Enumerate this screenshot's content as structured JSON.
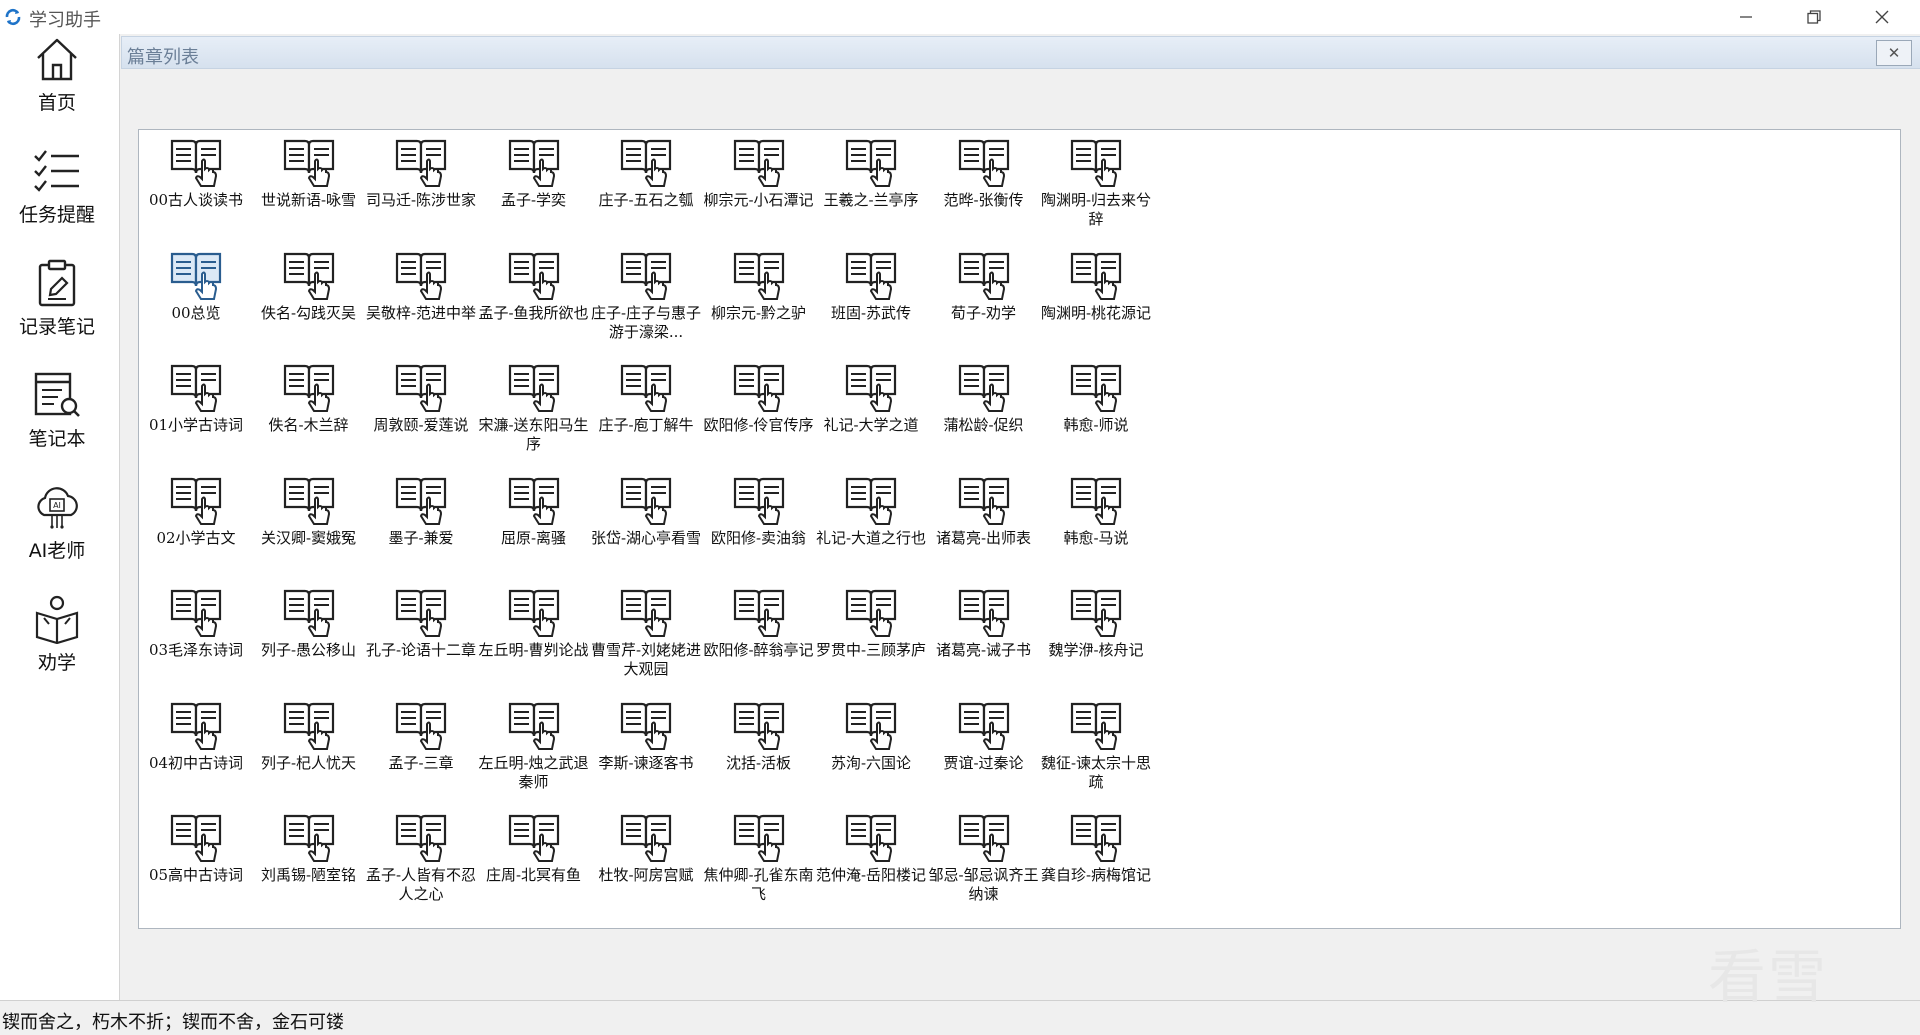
{
  "app": {
    "title": "学习助手"
  },
  "window_controls": {
    "minimize": "—",
    "maximize": "❐",
    "close": "✕"
  },
  "sidebar": {
    "items": [
      {
        "label": "首页",
        "icon": "home-icon"
      },
      {
        "label": "任务提醒",
        "icon": "checklist-icon"
      },
      {
        "label": "记录笔记",
        "icon": "note-edit-icon"
      },
      {
        "label": "笔记本",
        "icon": "notebook-search-icon"
      },
      {
        "label": "AI老师",
        "icon": "ai-cloud-icon"
      },
      {
        "label": "劝学",
        "icon": "reading-person-icon"
      }
    ]
  },
  "panel": {
    "title": "篇章列表",
    "close_glyph": "✕"
  },
  "chapters": {
    "columns": [
      [
        "00古人谈读书",
        "00总览",
        "01小学古诗词",
        "02小学古文",
        "03毛泽东诗词",
        "04初中古诗词",
        "05高中古诗词"
      ],
      [
        "世说新语-咏雪",
        "佚名-勾践灭吴",
        "佚名-木兰辞",
        "关汉卿-窦娥冤",
        "列子-愚公移山",
        "列子-杞人忧天",
        "刘禹锡-陋室铭"
      ],
      [
        "司马迁-陈涉世家",
        "吴敬梓-范进中举",
        "周敦颐-爱莲说",
        "墨子-兼爱",
        "孔子-论语十二章",
        "孟子-三章",
        "孟子-人皆有不忍人之心"
      ],
      [
        "孟子-学奕",
        "孟子-鱼我所欲也",
        "宋濂-送东阳马生序",
        "屈原-离骚",
        "左丘明-曹刿论战",
        "左丘明-烛之武退秦师",
        "庄周-北冥有鱼"
      ],
      [
        "庄子-五石之瓠",
        "庄子-庄子与惠子游于濠梁...",
        "庄子-庖丁解牛",
        "张岱-湖心亭看雪",
        "曹雪芹-刘姥姥进大观园",
        "李斯-谏逐客书",
        "杜牧-阿房宫赋"
      ],
      [
        "柳宗元-小石潭记",
        "柳宗元-黔之驴",
        "欧阳修-伶官传序",
        "欧阳修-卖油翁",
        "欧阳修-醉翁亭记",
        "沈括-活板",
        "焦仲卿-孔雀东南飞"
      ],
      [
        "王羲之-兰亭序",
        "班固-苏武传",
        "礼记-大学之道",
        "礼记-大道之行也",
        "罗贯中-三顾茅庐",
        "苏洵-六国论",
        "范仲淹-岳阳楼记"
      ],
      [
        "范晔-张衡传",
        "荀子-劝学",
        "蒲松龄-促织",
        "诸葛亮-出师表",
        "诸葛亮-诫子书",
        "贾谊-过秦论",
        "邹忌-邹忌讽齐王纳谏"
      ],
      [
        "陶渊明-归去来兮辞",
        "陶渊明-桃花源记",
        "韩愈-师说",
        "韩愈-马说",
        "魏学洢-核舟记",
        "魏征-谏太宗十思疏",
        "龚自珍-病梅馆记"
      ]
    ],
    "selected": "00总览"
  },
  "status": {
    "text": "锲而舍之，朽木不折；锲而不舍，金石可镂"
  },
  "watermark": {
    "text": "看雪"
  },
  "colors": {
    "accent": "#1e73c8",
    "panel_header": "#dbe5f1",
    "border": "#aeb6bf"
  }
}
